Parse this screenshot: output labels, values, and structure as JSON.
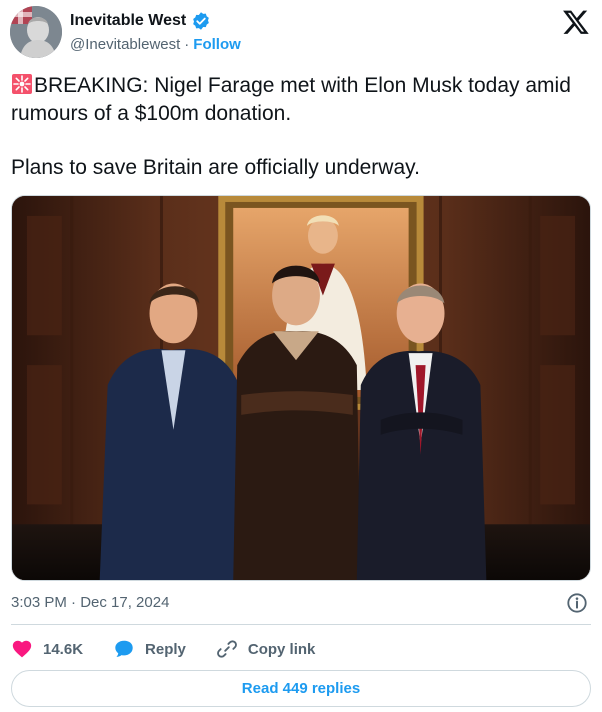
{
  "author": {
    "display_name": "Inevitable West",
    "handle": "@Inevitablewest",
    "separator": "·",
    "follow_label": "Follow"
  },
  "tweet": {
    "line1": "BREAKING: Nigel Farage met with Elon Musk today amid rumours of a $100m donation.",
    "line2": "Plans to save Britain are officially underway."
  },
  "meta": {
    "timestamp": "3:03 PM · Dec 17, 2024"
  },
  "actions": {
    "likes": "14.6K",
    "reply_label": "Reply",
    "copy_link_label": "Copy link"
  },
  "read_replies_label": "Read 449 replies",
  "icons": {
    "verified": "verified-badge-icon",
    "logo": "x-logo-icon",
    "siren": "police-light-emoji",
    "info": "info-icon",
    "like": "heart-icon",
    "reply": "speech-bubble-icon",
    "copy": "link-icon"
  },
  "colors": {
    "accent": "#1d9bf0",
    "like": "#f91880",
    "text": "#0f1419",
    "muted": "#536471",
    "border": "#cfd9de"
  }
}
